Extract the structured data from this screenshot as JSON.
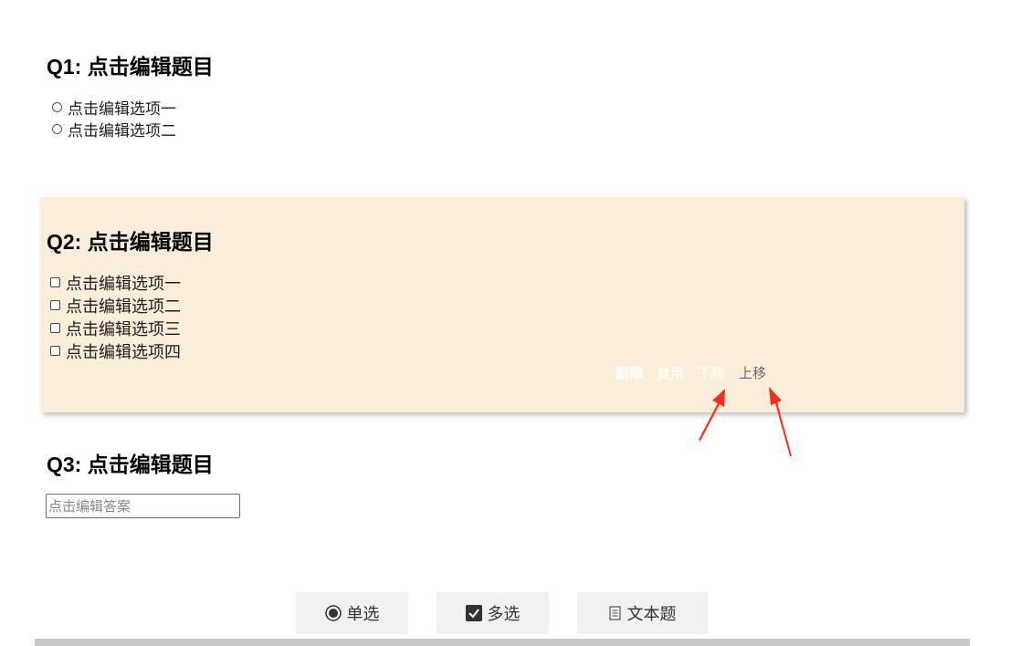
{
  "questions": [
    {
      "title": "Q1: 点击编辑题目",
      "type": "radio",
      "options": [
        "点击编辑选项一",
        "点击编辑选项二"
      ]
    },
    {
      "title": "Q2: 点击编辑题目",
      "type": "checkbox",
      "options": [
        "点击编辑选项一",
        "点击编辑选项二",
        "点击编辑选项三",
        "点击编辑选项四"
      ],
      "actions": {
        "delete": "删除",
        "copy": "复用",
        "move_down": "下移",
        "move_up": "上移"
      }
    },
    {
      "title": "Q3: 点击编辑题目",
      "type": "text",
      "placeholder": "点击编辑答案",
      "value": ""
    }
  ],
  "toolbar": {
    "single_label": "单选",
    "multi_label": "多选",
    "text_label": "文本题",
    "single_icon": "radio-icon",
    "multi_icon": "checkbox-checked-icon",
    "text_icon": "document-icon"
  },
  "colors": {
    "card_background": "#faeeda",
    "annotation_arrow": "#ff2a1a",
    "toolbar_button": "#f1f1f1",
    "bottom_bar": "#c8c8c8"
  }
}
